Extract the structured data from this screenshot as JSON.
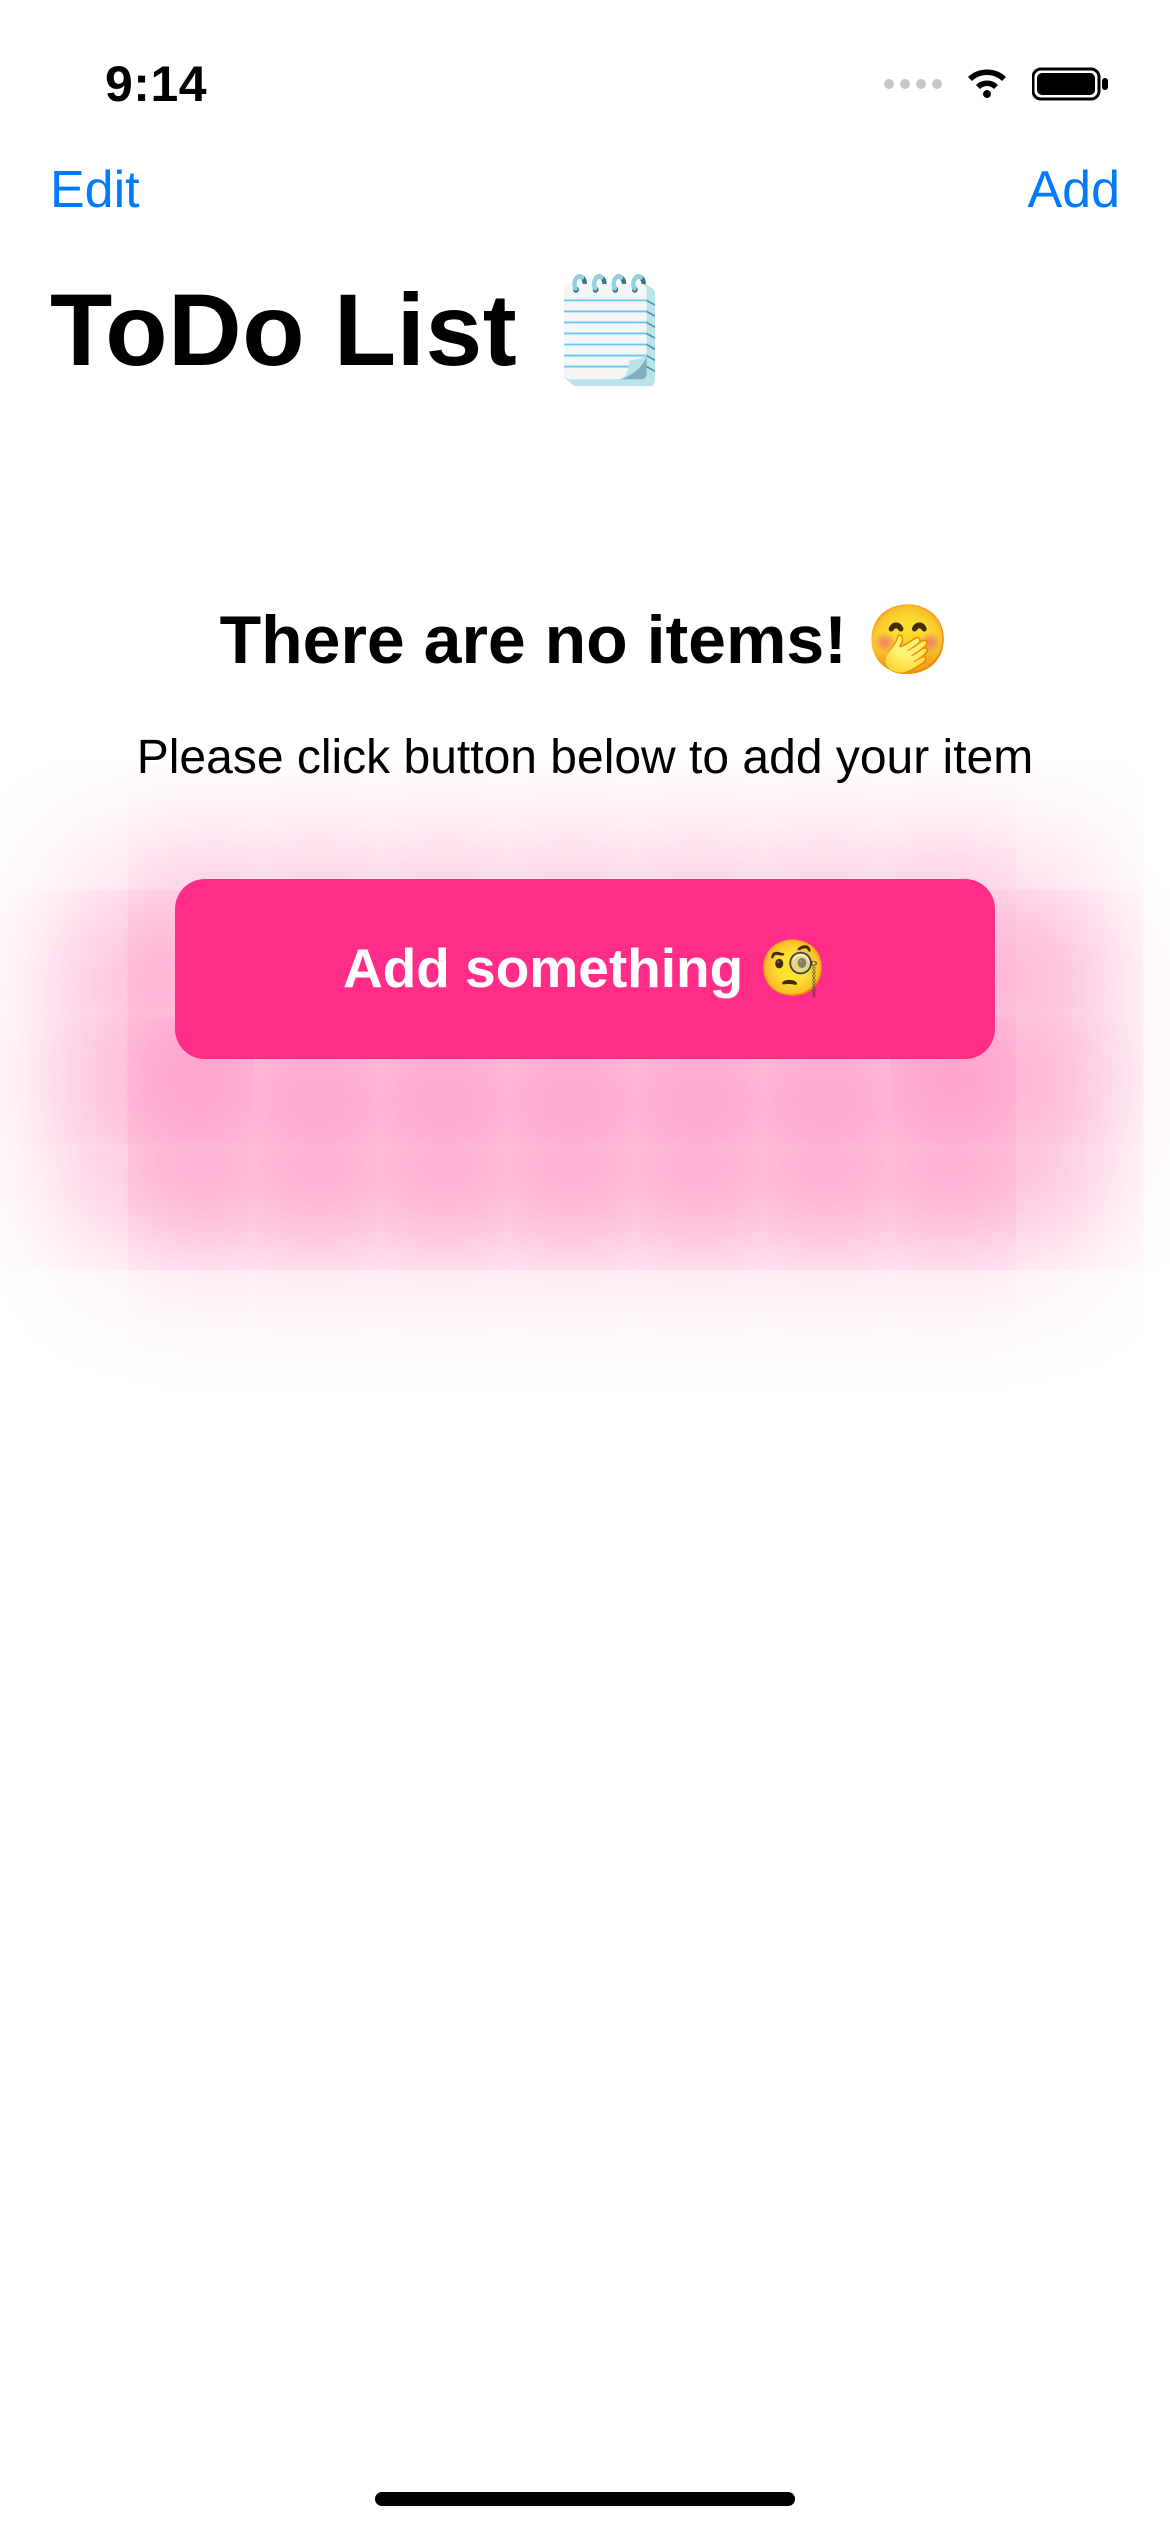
{
  "status": {
    "time": "9:14"
  },
  "nav": {
    "edit_label": "Edit",
    "add_label": "Add"
  },
  "page": {
    "title": "ToDo List 🗒️"
  },
  "empty": {
    "heading": "There are no items! 🤭",
    "subtext": "Please click button below to add your item",
    "cta_label": "Add something 🧐"
  },
  "colors": {
    "accent": "#007aff",
    "cta_bg": "#ff2d87"
  }
}
